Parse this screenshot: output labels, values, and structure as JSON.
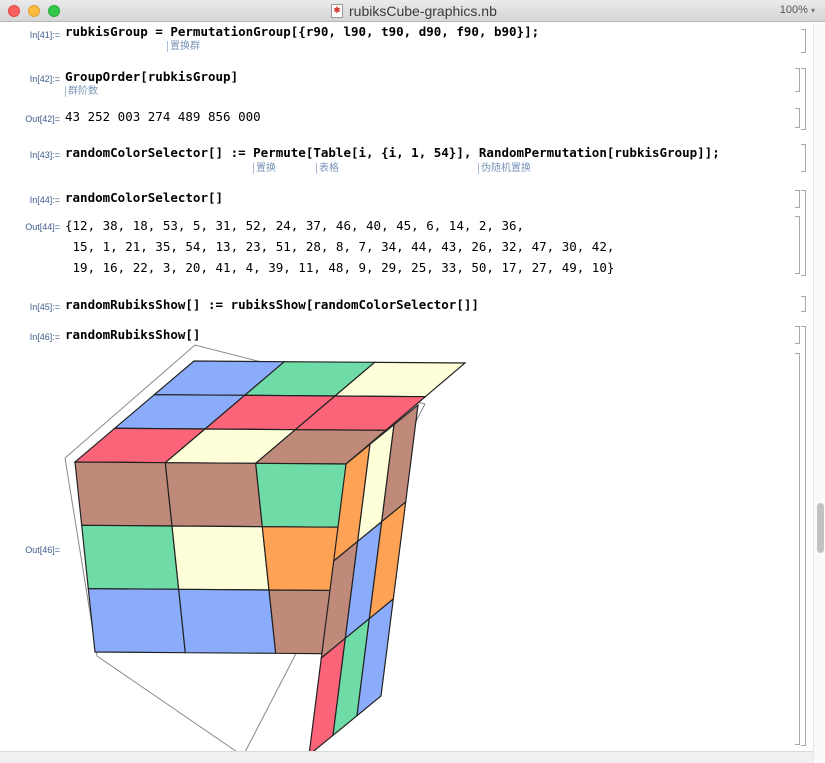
{
  "window": {
    "title": "rubiksCube-graphics.nb",
    "zoom": "100%"
  },
  "cells": {
    "in41": {
      "label": "In[41]:=",
      "code": "rubkisGroup = PermutationGroup[{r90, l90, t90, d90, f90, b90}];",
      "hint": "置换群"
    },
    "in42": {
      "label": "In[42]:=",
      "code": "GroupOrder[rubkisGroup]",
      "hint": "群阶数"
    },
    "out42": {
      "label": "Out[42]=",
      "text": "43 252 003 274 489 856 000"
    },
    "in43": {
      "label": "In[43]:=",
      "code": "randomColorSelector[] := Permute[Table[i, {i, 1, 54}], RandomPermutation[rubkisGroup]];",
      "hints": [
        "置换",
        "表格",
        "伪随机置换"
      ]
    },
    "in44": {
      "label": "In[44]:=",
      "code": "randomColorSelector[]"
    },
    "out44": {
      "label": "Out[44]=",
      "lines": [
        "{12, 38, 18, 53, 5, 31, 52, 24, 37, 46, 40, 45, 6, 14, 2, 36,",
        " 15, 1, 21, 35, 54, 13, 23, 51, 28, 8, 7, 34, 44, 43, 26, 32, 47, 30, 42,",
        " 19, 16, 22, 3, 20, 41, 4, 39, 11, 48, 9, 29, 25, 33, 50, 17, 27, 49, 10}"
      ]
    },
    "in45": {
      "label": "In[45]:=",
      "code": "randomRubiksShow[] := rubiksShow[randomColorSelector[]]"
    },
    "in46": {
      "label": "In[46]:=",
      "code": "randomRubiksShow[]"
    },
    "out46": {
      "label": "Out[46]="
    }
  },
  "cube": {
    "colors": {
      "blue": "#8aacfa",
      "green": "#6fdba6",
      "yellow": "#fefed8",
      "red": "#fb6479",
      "brown": "#c08a7a",
      "orange": "#fea356"
    },
    "top": [
      [
        "blue",
        "green",
        "yellow"
      ],
      [
        "blue",
        "red",
        "red"
      ],
      [
        "red",
        "yellow",
        "brown"
      ]
    ],
    "front": [
      [
        "brown",
        "brown",
        "green"
      ],
      [
        "green",
        "yellow",
        "orange"
      ],
      [
        "blue",
        "blue",
        "brown"
      ]
    ],
    "right": [
      [
        "orange",
        "yellow",
        "brown"
      ],
      [
        "brown",
        "blue",
        "orange"
      ],
      [
        "red",
        "green",
        "blue"
      ]
    ]
  }
}
